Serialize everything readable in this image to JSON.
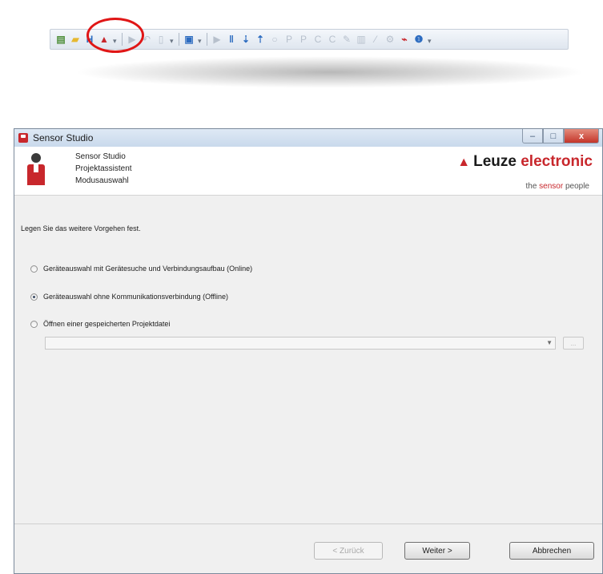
{
  "toolbar": {
    "icons": [
      "new-document-icon",
      "open-folder-icon",
      "save-icon",
      "upload-to-device-icon",
      "dropdown-grip",
      "play-icon",
      "undo-icon",
      "redo-icon",
      "dropdown-grip",
      "view-icon",
      "dropdown-grip",
      "play-icon",
      "pause-icon",
      "download-icon",
      "upload-icon",
      "record-icon",
      "param-icon",
      "param-icon",
      "curve-icon",
      "curve-icon",
      "edit-icon",
      "chart-icon",
      "compare-icon",
      "settings-icon",
      "connect-icon",
      "info-icon",
      "dropdown-grip"
    ],
    "highlight_color": "#e01616"
  },
  "window": {
    "title": "Sensor Studio",
    "controls": {
      "minimize": "–",
      "maximize": "□",
      "close": "x"
    }
  },
  "header": {
    "line1": "Sensor Studio",
    "line2": "Projektassistent",
    "line3": "Modusauswahl",
    "brand_word1": "Leuze",
    "brand_word2": "electronic",
    "tagline_part1": "the",
    "tagline_part2": "sensor",
    "tagline_part3": "people",
    "brand_color": "#c8272c"
  },
  "content": {
    "instruction": "Legen Sie das weitere Vorgehen fest.",
    "options": [
      {
        "label": "Geräteauswahl mit Gerätesuche und Verbindungsaufbau (Online)",
        "selected": false
      },
      {
        "label": "Geräteauswahl ohne Kommunikationsverbindung (Offline)",
        "selected": true
      },
      {
        "label": "Öffnen einer gespeicherten Projektdatei",
        "selected": false
      }
    ],
    "project_path_value": "",
    "browse_label": "..."
  },
  "footer": {
    "back_label": "< Zurück",
    "next_label": "Weiter >",
    "cancel_label": "Abbrechen"
  }
}
